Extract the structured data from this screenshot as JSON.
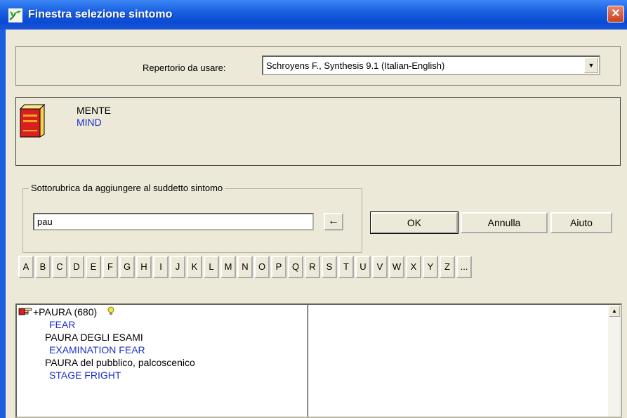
{
  "window": {
    "title": "Finestra selezione sintomo",
    "close_glyph": "✕"
  },
  "repertory": {
    "label": "Repertorio da usare:",
    "selected": "Schroyens F., Synthesis 9.1 (Italian-English)",
    "dropdown_glyph": "▼"
  },
  "symptom": {
    "italian": "MENTE",
    "english": "MIND"
  },
  "subrubric": {
    "group_label": "Sottorubrica da aggiungere al suddetto sintomo",
    "value": "pau",
    "arrow_glyph": "←"
  },
  "buttons": {
    "ok": "OK",
    "cancel": "Annulla",
    "help": "Aiuto"
  },
  "letters": [
    "A",
    "B",
    "C",
    "D",
    "E",
    "F",
    "G",
    "H",
    "I",
    "J",
    "K",
    "L",
    "M",
    "N",
    "O",
    "P",
    "Q",
    "R",
    "S",
    "T",
    "U",
    "V",
    "W",
    "X",
    "Y",
    "Z",
    "..."
  ],
  "results": {
    "first_label": "+PAURA (680)",
    "items": [
      {
        "text": "FEAR",
        "lang": "en"
      },
      {
        "text": "PAURA DEGLI ESAMI",
        "lang": "it"
      },
      {
        "text": "EXAMINATION FEAR",
        "lang": "en"
      },
      {
        "text": "PAURA del pubblico, palcoscenico",
        "lang": "it"
      },
      {
        "text": "STAGE FRIGHT",
        "lang": "en"
      }
    ],
    "scroll_up_glyph": "▲"
  },
  "icons": {
    "app": "app-leaf-icon",
    "close": "close-icon",
    "book": "book-icon",
    "pointer": "pointing-hand-icon",
    "bulb": "lightbulb-icon"
  },
  "colors": {
    "title_bar": "#1a5fe0",
    "english_text": "#1b2fc7",
    "book": "#d81e1e"
  }
}
